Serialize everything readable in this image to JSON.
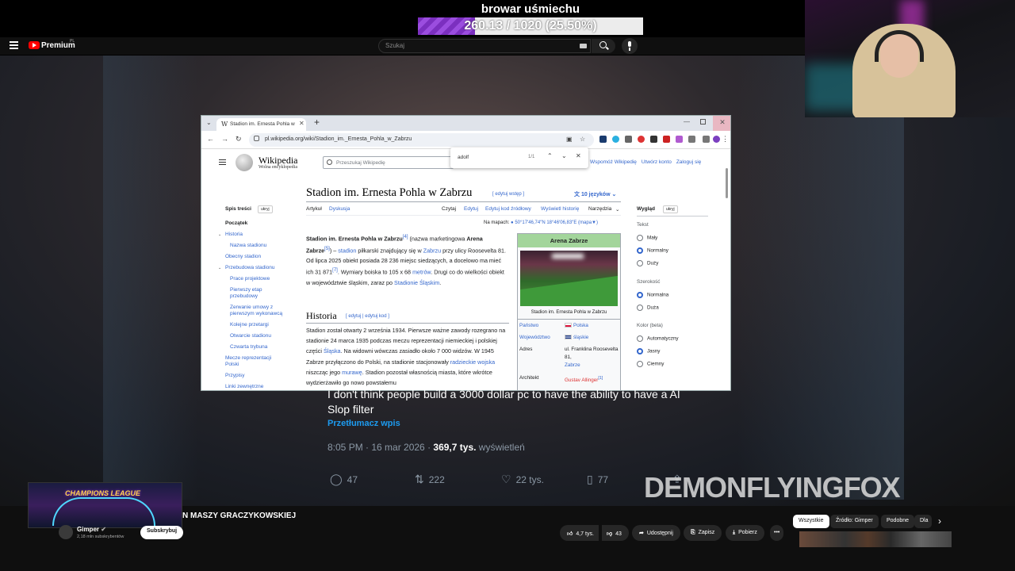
{
  "stream_goal": {
    "title": "browar uśmiechu",
    "progress_text": "260.13 / 1020 (25.50%)",
    "progress_fraction": 0.255
  },
  "youtube_header": {
    "brand": "Premium",
    "brand_sup": "PL",
    "search_placeholder": "Szukaj"
  },
  "browser": {
    "tab_title": "Stadion im. Ernesta Pohla w Zabrzu",
    "url": "pl.wikipedia.org/wiki/Stadion_im._Ernesta_Pohla_w_Zabrzu",
    "find": {
      "query": "adolf",
      "count": "1/1"
    }
  },
  "wiki": {
    "logo_name": "Wikipedia",
    "logo_tagline": "Wolna encyklopedia",
    "search_placeholder": "Przeszukaj Wikipedię",
    "top_links": [
      "Wspomóż Wikipedię",
      "Utwórz konto",
      "Zaloguj się"
    ],
    "title": "Stadion im. Ernesta Pohla w Zabrzu",
    "edit_intro": "[ edytuj wstęp ]",
    "languages": "10 języków",
    "tabs_left": [
      "Artykuł",
      "Dyskusja"
    ],
    "tabs_right": [
      "Czytaj",
      "Edytuj",
      "Edytuj kod źródłowy",
      "Wyświetl historię",
      "Narzędzia"
    ],
    "toc": {
      "title": "Spis treści",
      "hide": "ukryj",
      "items": [
        "Początek",
        "Historia",
        "Nazwa stadionu",
        "Obecny stadion",
        "Przebudowa stadionu",
        "Prace projektowe",
        "Pierwszy etap przebudowy",
        "Zerwanie umowy z pierwszym wykonawcą",
        "Kolejne przetargi",
        "Otwarcie stadionu",
        "Czwarta trybuna",
        "Mecze reprezentacji Polski",
        "Przypisy",
        "Linki zewnętrzne"
      ]
    },
    "coords": {
      "label": "Na mapach:",
      "value": "50°17′46,74″N 18°46′06,83″E",
      "map": "(mapa▼)"
    },
    "intro": {
      "bold1": "Stadion im. Ernesta Pohla w Zabrzu",
      "ref1": "[4]",
      "t1": " (nazwa marketingowa ",
      "bold2": "Arena Zabrze",
      "ref2": "[5]",
      "t2": ") – ",
      "l_stadion": "stadion",
      "t3": " piłkarski znajdujący się w ",
      "l_zabrze": "Zabrzu",
      "t4": " przy ulicy Roosevelta 81. Od lipca 2025 obiekt posiada 28 236 miejsc siedzących, a docelowo ma mieć ich 31 871",
      "ref3": "[7]",
      "t5": ". Wymiary boiska to 105 x 68 ",
      "l_metrow": "metrów",
      "t6": ". Drugi co do wielkości obiekt w województwie śląskim, zaraz po ",
      "l_slaski": "Stadionie Śląskim",
      "t7": "."
    },
    "history": {
      "heading": "Historia",
      "edit": "[ edytuj | edytuj kod ]",
      "t1": "Stadion został otwarty 2 września 1934. Pierwsze ważne zawody rozegrano na stadionie 24 marca 1935 podczas meczu reprezentacji niemieckiej i polskiej części ",
      "l_slaska": "Śląska",
      "t2": ". Na widowni wówczas zasiadło około 7 000 widzów. W 1945 Zabrze przyłączono do Polski, na stadionie stacjonowały ",
      "l_wojska": "radzieckie wojska",
      "t3": " niszcząc jego ",
      "l_murawe": "murawę",
      "t4": ". Stadion pozostał własnością miasta, które wkrótce wydzierżawiło go nowo powstałemu"
    },
    "infobox": {
      "title": "Arena Zabrze",
      "caption": "Stadion im. Ernesta Pohla w Zabrzu",
      "rows": [
        {
          "label": "Państwo",
          "value": "Polska"
        },
        {
          "label": "Województwo",
          "value": "śląskie"
        },
        {
          "label": "Adres",
          "value": "ul. Franklina Roosevelta 81,",
          "value_link": "Zabrze"
        },
        {
          "label": "Architekt",
          "value": "Gustav Allinger",
          "ref": "[1]"
        }
      ]
    },
    "appearance": {
      "title": "Wygląd",
      "hide": "ukryj",
      "text_label": "Tekst",
      "text_options": [
        "Mały",
        "Normalny",
        "Duży"
      ],
      "width_label": "Szerokość",
      "width_options": [
        "Normalna",
        "Duża"
      ],
      "color_label": "Kolor (beta)",
      "color_options": [
        "Automatyczny",
        "Jasny",
        "Ciemny"
      ]
    }
  },
  "tweet": {
    "text": "I don't think people build a 3000 dollar pc to have the ability to have a AI Slop filter",
    "translate": "Przetłumacz wpis",
    "time": "8:05 PM · 16 mar 2026 · ",
    "views": "369,7 tys.",
    "views_label": " wyświetleń",
    "replies": "47",
    "reposts": "222",
    "likes": "22 tys.",
    "bookmarks": "77"
  },
  "watermark": "DEMONFLYINGFOX",
  "video": {
    "thumb_title": "CHAMPIONS LEAGUE",
    "title_fragment": "N MASZY GRACZYKOWSKIEJ",
    "channel": "Gimper",
    "subs": "2,18 mln subskrybentów",
    "subscribe": "Subskrybuj",
    "likes": "4,7 tys.",
    "dislikes": "43",
    "share": "Udostępnij",
    "save": "Zapisz",
    "download": "Pobierz",
    "more": "•••",
    "chips": [
      "Wszystkie",
      "Źródło: Gimper",
      "Podobne",
      "Dla"
    ]
  }
}
